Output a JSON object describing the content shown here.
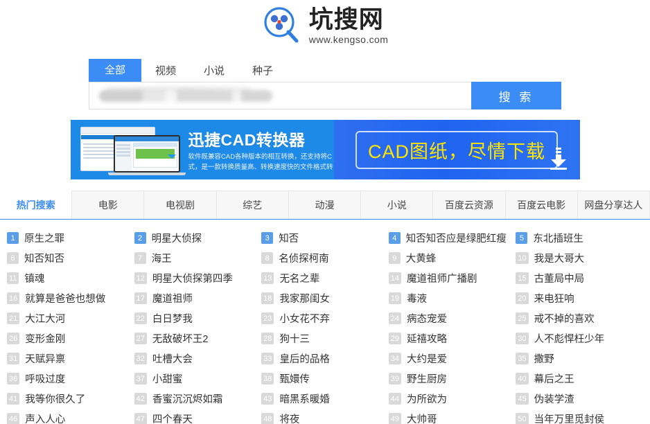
{
  "logo": {
    "icon": "magnifier-cloud-logo",
    "title": "坑搜网",
    "domain": "www.kengso.com"
  },
  "search": {
    "tabs": [
      {
        "label": "全部",
        "active": true
      },
      {
        "label": "视频",
        "active": false
      },
      {
        "label": "小说",
        "active": false
      },
      {
        "label": "种子",
        "active": false
      }
    ],
    "input_value": "",
    "placeholder": "",
    "placeholder_state": "blurred",
    "button_label": "搜 索",
    "accent_color": "#3b8cf5"
  },
  "banner": {
    "title": "迅捷CAD转换器",
    "desc_line1": "软件既兼容CAD各种版本的相互转换，还支持将C",
    "desc_line2": "式，是一款转换质量高、转换速度快的文件格式转",
    "cta": "CAD图纸，尽情下载",
    "cta_color": "#ffe400",
    "bg_color": "#1e8ae8",
    "download_icon": "download-arrow-icon"
  },
  "nav": {
    "items": [
      {
        "label": "热门搜索",
        "active": true
      },
      {
        "label": "电影",
        "active": false
      },
      {
        "label": "电视剧",
        "active": false
      },
      {
        "label": "综艺",
        "active": false
      },
      {
        "label": "动漫",
        "active": false
      },
      {
        "label": "小说",
        "active": false
      },
      {
        "label": "百度云资源",
        "active": false
      },
      {
        "label": "百度云电影",
        "active": false
      },
      {
        "label": "网盘分享达人",
        "active": false
      }
    ],
    "active_color": "#3b8cf5"
  },
  "hot_list": {
    "top_rank_color": "#5b9ee8",
    "rank_color": "#d9d9d9",
    "items": [
      {
        "rank": 1,
        "title": "原生之罪"
      },
      {
        "rank": 2,
        "title": "明星大侦探"
      },
      {
        "rank": 3,
        "title": "知否"
      },
      {
        "rank": 4,
        "title": "知否知否应是绿肥红瘦"
      },
      {
        "rank": 5,
        "title": "东北插班生"
      },
      {
        "rank": 6,
        "title": "知否知否"
      },
      {
        "rank": 7,
        "title": "海王"
      },
      {
        "rank": 8,
        "title": "名侦探柯南"
      },
      {
        "rank": 9,
        "title": "大黄蜂"
      },
      {
        "rank": 10,
        "title": "我是大哥大"
      },
      {
        "rank": 11,
        "title": "镇魂"
      },
      {
        "rank": 12,
        "title": "明星大侦探第四季"
      },
      {
        "rank": 13,
        "title": "无名之辈"
      },
      {
        "rank": 14,
        "title": "魔道祖师广播剧"
      },
      {
        "rank": 15,
        "title": "古董局中局"
      },
      {
        "rank": 16,
        "title": "就算是爸爸也想做"
      },
      {
        "rank": 17,
        "title": "魔道祖师"
      },
      {
        "rank": 18,
        "title": "我家那闺女"
      },
      {
        "rank": 19,
        "title": "毒液"
      },
      {
        "rank": 20,
        "title": "来电狂响"
      },
      {
        "rank": 21,
        "title": "大江大河"
      },
      {
        "rank": 22,
        "title": "白日梦我"
      },
      {
        "rank": 23,
        "title": "小女花不弃"
      },
      {
        "rank": 24,
        "title": "病态宠爱"
      },
      {
        "rank": 25,
        "title": "戒不掉的喜欢"
      },
      {
        "rank": 26,
        "title": "变形金刚"
      },
      {
        "rank": 27,
        "title": "无敌破坏王2"
      },
      {
        "rank": 28,
        "title": "狗十三"
      },
      {
        "rank": 29,
        "title": "延禧攻略"
      },
      {
        "rank": 30,
        "title": "人不彪悍枉少年"
      },
      {
        "rank": 31,
        "title": "天赋异禀"
      },
      {
        "rank": 32,
        "title": "吐槽大会"
      },
      {
        "rank": 33,
        "title": "皇后的品格"
      },
      {
        "rank": 34,
        "title": "大约是爱"
      },
      {
        "rank": 35,
        "title": "撒野"
      },
      {
        "rank": 36,
        "title": "呼吸过度"
      },
      {
        "rank": 37,
        "title": "小甜蜜"
      },
      {
        "rank": 38,
        "title": "甄嬛传"
      },
      {
        "rank": 39,
        "title": "野生厨房"
      },
      {
        "rank": 40,
        "title": "幕后之王"
      },
      {
        "rank": 41,
        "title": "我等你很久了"
      },
      {
        "rank": 42,
        "title": "香蜜沉沉烬如霜"
      },
      {
        "rank": 43,
        "title": "暗黑系暖婚"
      },
      {
        "rank": 44,
        "title": "为所欲为"
      },
      {
        "rank": 45,
        "title": "伪装学渣"
      },
      {
        "rank": 46,
        "title": "声入人心"
      },
      {
        "rank": 47,
        "title": "四个春天"
      },
      {
        "rank": 48,
        "title": "将夜"
      },
      {
        "rank": 49,
        "title": "大帅哥"
      },
      {
        "rank": 50,
        "title": "当年万里觅封侯"
      }
    ]
  }
}
